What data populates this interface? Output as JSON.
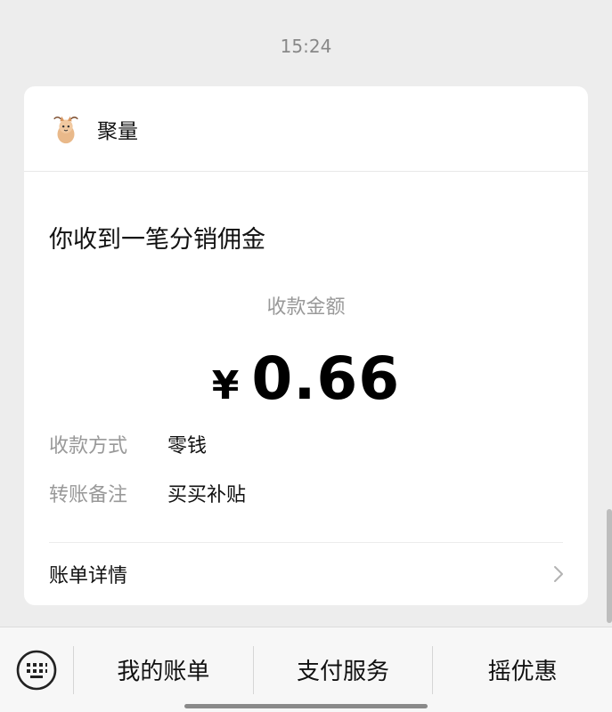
{
  "timestamp": "15:24",
  "card": {
    "sender_name": "聚量",
    "avatar_icon": "cat-avatar-icon",
    "headline": "你收到一笔分销佣金",
    "amount_label": "收款金额",
    "currency_symbol": "¥",
    "amount_value": "0.66",
    "info": [
      {
        "key": "收款方式",
        "value": "零钱"
      },
      {
        "key": "转账备注",
        "value": "买买补贴"
      }
    ],
    "detail_label": "账单详情",
    "detail_icon": "chevron-right-icon"
  },
  "bottom_menu": {
    "keyboard_icon": "keyboard-icon",
    "items": [
      "我的账单",
      "支付服务",
      "摇优惠"
    ]
  }
}
